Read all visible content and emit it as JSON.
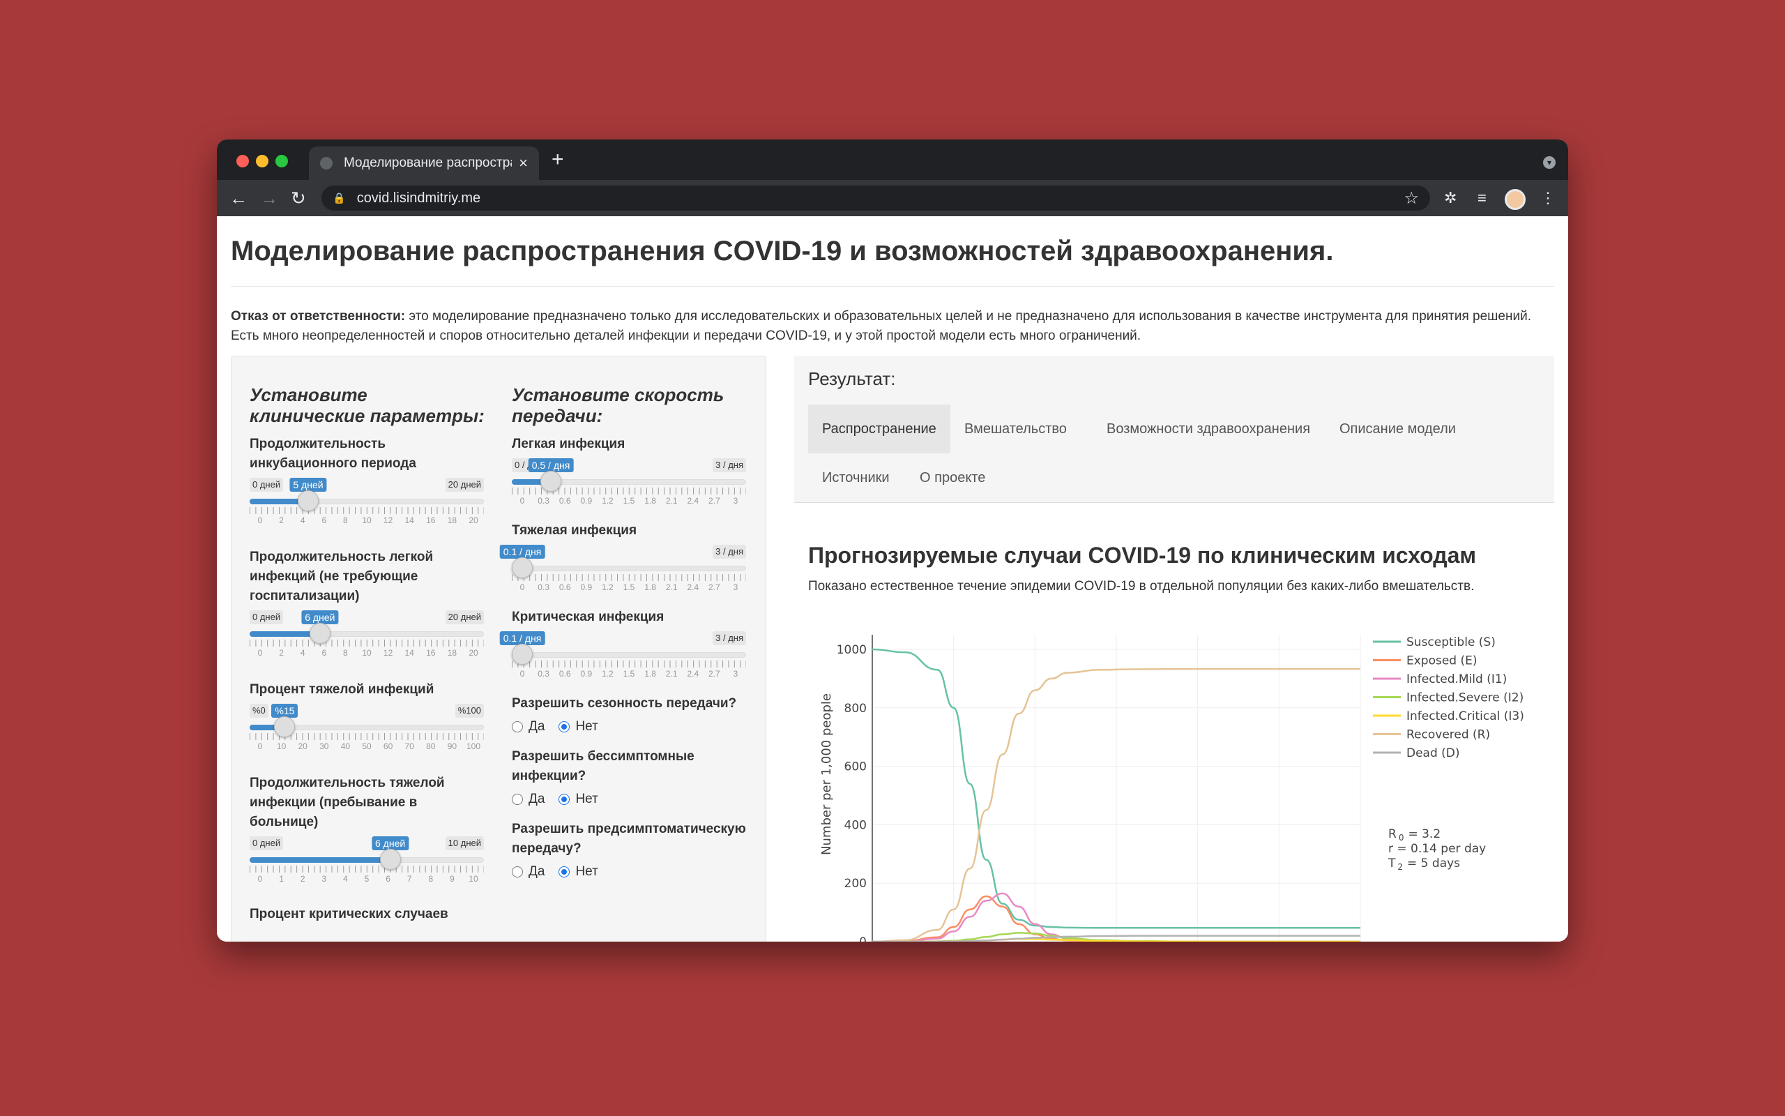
{
  "browser": {
    "tab_title": "Моделирование распространения COVID-19",
    "url": "covid.lisindmitriy.me"
  },
  "page": {
    "title": "Моделирование распространения COVID-19 и возможностей здравоохранения.",
    "disclaimer_label": "Отказ от ответственности:",
    "disclaimer_text": " это моделирование предназначено только для исследовательских и образовательных целей и не предназначено для использования в качестве инструмента для принятия решений. Есть много неопределенностей и споров относительно деталей инфекции и передачи COVID-19, и у этой простой модели есть много ограничений."
  },
  "clinical": {
    "title": "Установите клинические параметры:",
    "incubation": {
      "label": "Продолжительность инкубационного периода",
      "min": "0 дней",
      "max": "20 дней",
      "value_label": "5 дней",
      "value": 5,
      "range": [
        0,
        20
      ],
      "ticks": [
        "0",
        "2",
        "4",
        "6",
        "8",
        "10",
        "12",
        "14",
        "16",
        "18",
        "20"
      ]
    },
    "mild_duration": {
      "label": "Продолжительность легкой инфекций (не требующие госпитализации)",
      "min": "0 дней",
      "max": "20 дней",
      "value_label": "6 дней",
      "value": 6,
      "range": [
        0,
        20
      ],
      "ticks": [
        "0",
        "2",
        "4",
        "6",
        "8",
        "10",
        "12",
        "14",
        "16",
        "18",
        "20"
      ]
    },
    "severe_percent": {
      "label": "Процент тяжелой инфекций",
      "min": "%0",
      "max": "%100",
      "value_label": "%15",
      "value": 15,
      "range": [
        0,
        100
      ],
      "ticks": [
        "0",
        "10",
        "20",
        "30",
        "40",
        "50",
        "60",
        "70",
        "80",
        "90",
        "100"
      ]
    },
    "severe_duration": {
      "label": "Продолжительность тяжелой инфекции (пребывание в больнице)",
      "min": "0 дней",
      "max": "10 дней",
      "value_label": "6 дней",
      "value": 6,
      "range": [
        0,
        10
      ],
      "ticks": [
        "0",
        "1",
        "2",
        "3",
        "4",
        "5",
        "6",
        "7",
        "8",
        "9",
        "10"
      ]
    },
    "critical_percent_label": "Процент критических случаев"
  },
  "transmission": {
    "title": "Установите скорость передачи:",
    "mild": {
      "label": "Легкая инфекция",
      "min": "0 / дня",
      "max": "3 / дня",
      "value_label": "0.5 / дня",
      "value": 0.5,
      "range": [
        0,
        3
      ],
      "ticks": [
        "0",
        "0.3",
        "0.6",
        "0.9",
        "1.2",
        "1.5",
        "1.8",
        "2.1",
        "2.4",
        "2.7",
        "3"
      ]
    },
    "severe": {
      "label": "Тяжелая инфекция",
      "min": "0 / дня",
      "max": "3 / дня",
      "value_label": "0.1 / дня",
      "value": 0.1,
      "range": [
        0,
        3
      ],
      "ticks": [
        "0",
        "0.3",
        "0.6",
        "0.9",
        "1.2",
        "1.5",
        "1.8",
        "2.1",
        "2.4",
        "2.7",
        "3"
      ]
    },
    "critical": {
      "label": "Критическая инфекция",
      "min": "0 / дня",
      "max": "3 / дня",
      "value_label": "0.1 / дня",
      "value": 0.1,
      "range": [
        0,
        3
      ],
      "ticks": [
        "0",
        "0.3",
        "0.6",
        "0.9",
        "1.2",
        "1.5",
        "1.8",
        "2.1",
        "2.4",
        "2.7",
        "3"
      ]
    },
    "seasonality": {
      "label": "Разрешить сезонность передачи?",
      "yes": "Да",
      "no": "Нет",
      "selected": "no"
    },
    "asymptomatic": {
      "label": "Разрешить бессимптомные инфекции?",
      "yes": "Да",
      "no": "Нет",
      "selected": "no"
    },
    "presymptomatic": {
      "label": "Разрешить предсимптоматическую передачу?",
      "yes": "Да",
      "no": "Нет",
      "selected": "no"
    }
  },
  "results": {
    "title": "Результат:",
    "tabs": [
      "Распространение",
      "Вмешательство",
      "Возможности здравоохранения",
      "Описание модели",
      "Источники",
      "О проекте"
    ],
    "active_tab": 0,
    "chart_title": "Прогнозируемые случаи COVID-19 по клиническим исходам",
    "chart_subtitle": "Показано естественное течение эпидемии COVID-19 в отдельной популяции без каких-либо вмешательств.",
    "annotation": {
      "r0_label": "R",
      "r0_sub": "0",
      "r0_value": "= 3.2",
      "r_line": "r = 0.14  per day",
      "t2_label": "T",
      "t2_sub": "2",
      "t2_value": "=   5  days"
    }
  },
  "chart_data": {
    "type": "line",
    "ylabel": "Number per 1,000 people",
    "xlabel": "",
    "ylim": [
      0,
      1050
    ],
    "yticks": [
      0,
      200,
      400,
      600,
      800,
      1000
    ],
    "xlim": [
      0,
      300
    ],
    "grid": true,
    "legend_position": "right",
    "x": [
      0,
      20,
      40,
      50,
      60,
      70,
      80,
      90,
      100,
      110,
      120,
      140,
      160,
      200,
      250,
      300
    ],
    "series": [
      {
        "name": "Susceptible (S)",
        "color": "#66c2a5",
        "values": [
          1000,
          990,
          930,
          800,
          540,
          280,
          130,
          75,
          55,
          50,
          48,
          47,
          47,
          47,
          47,
          47
        ]
      },
      {
        "name": "Exposed (E)",
        "color": "#fc8d62",
        "values": [
          0,
          2,
          15,
          50,
          110,
          155,
          120,
          60,
          25,
          10,
          4,
          1,
          0,
          0,
          0,
          0
        ]
      },
      {
        "name": "Infected.Mild (I1)",
        "color": "#e78ac3",
        "values": [
          0,
          1,
          10,
          35,
          85,
          140,
          165,
          120,
          60,
          25,
          10,
          3,
          1,
          0,
          0,
          0
        ]
      },
      {
        "name": "Infected.Severe (I2)",
        "color": "#a6d854",
        "values": [
          0,
          0,
          1,
          3,
          8,
          16,
          25,
          30,
          28,
          20,
          12,
          5,
          2,
          0,
          0,
          0
        ]
      },
      {
        "name": "Infected.Critical (I3)",
        "color": "#ffd92f",
        "values": [
          0,
          0,
          0,
          1,
          2,
          4,
          7,
          9,
          9,
          7,
          5,
          2,
          1,
          0,
          0,
          0
        ]
      },
      {
        "name": "Recovered (R)",
        "color": "#e5c494",
        "values": [
          0,
          5,
          40,
          110,
          250,
          450,
          640,
          780,
          860,
          900,
          920,
          930,
          932,
          933,
          933,
          933
        ]
      },
      {
        "name": "Dead (D)",
        "color": "#b3b3b3",
        "values": [
          0,
          0,
          0,
          1,
          2,
          4,
          7,
          10,
          13,
          15,
          17,
          19,
          20,
          20,
          20,
          20
        ]
      }
    ]
  }
}
